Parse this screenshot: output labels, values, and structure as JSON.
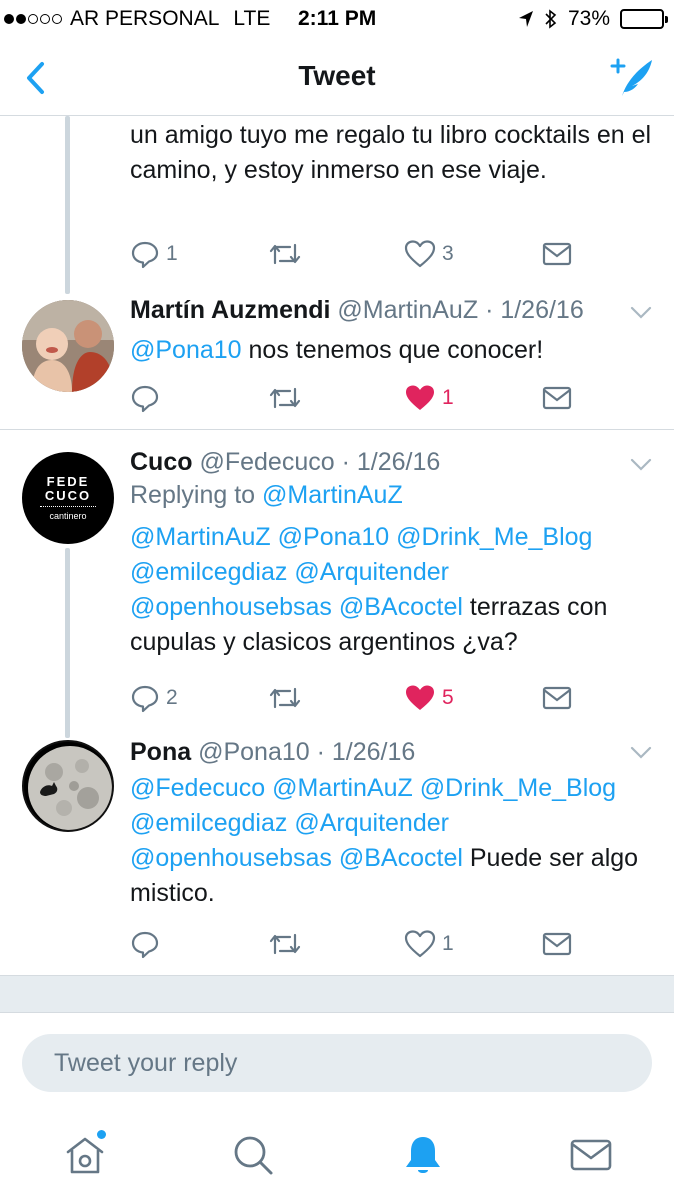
{
  "status": {
    "carrier": "AR PERSONAL",
    "network": "LTE",
    "time": "2:11 PM",
    "battery": "73%",
    "battery_level": 0.73
  },
  "nav": {
    "title": "Tweet",
    "back_icon": "chevron-left-icon",
    "compose_icon": "compose-tweet-icon"
  },
  "colors": {
    "accent": "#1da1f2",
    "like": "#e0245e",
    "muted": "#657786"
  },
  "tweets": [
    {
      "text": "un amigo tuyo me regalo tu libro cocktails en el camino, y estoy inmerso en ese viaje.",
      "replies": "1",
      "retweets": "",
      "likes": "3",
      "liked": false
    },
    {
      "name": "Martín Auzmendi",
      "handle": "@MartinAuZ",
      "date": "· 1/26/16",
      "mention": "@Pona10",
      "text": "nos tenemos que conocer!",
      "replies": "",
      "retweets": "",
      "likes": "1",
      "liked": true
    },
    {
      "name": "Cuco",
      "handle": "@Fedecuco",
      "date": "· 1/26/16",
      "replying_label": "Replying to",
      "replying_to": "@MartinAuZ",
      "mentions": [
        "@MartinAuZ",
        "@Pona10",
        "@Drink_Me_Blog",
        "@emilcegdiaz",
        "@Arquitender",
        "@openhousebsas",
        "@BAcoctel"
      ],
      "text": "terrazas con cupulas y clasicos argentinos ¿va?",
      "replies": "2",
      "retweets": "",
      "likes": "5",
      "liked": true,
      "avatar_text": [
        "FEDE",
        "CUCO",
        "cantinero"
      ]
    },
    {
      "name": "Pona",
      "handle": "@Pona10",
      "date": "· 1/26/16",
      "mentions": [
        "@Fedecuco",
        "@MartinAuZ",
        "@Drink_Me_Blog",
        "@emilcegdiaz",
        "@Arquitender",
        "@openhousebsas",
        "@BAcoctel"
      ],
      "text": "Puede ser algo mistico.",
      "replies": "",
      "retweets": "",
      "likes": "1",
      "liked": false
    }
  ],
  "reply": {
    "placeholder": "Tweet your reply"
  },
  "tabbar": {
    "items": [
      {
        "icon": "home-icon",
        "label": "Home",
        "has_badge": true
      },
      {
        "icon": "search-icon",
        "label": "Search"
      },
      {
        "icon": "bell-icon",
        "label": "Notifications",
        "active": true
      },
      {
        "icon": "mail-icon",
        "label": "Messages"
      }
    ]
  }
}
